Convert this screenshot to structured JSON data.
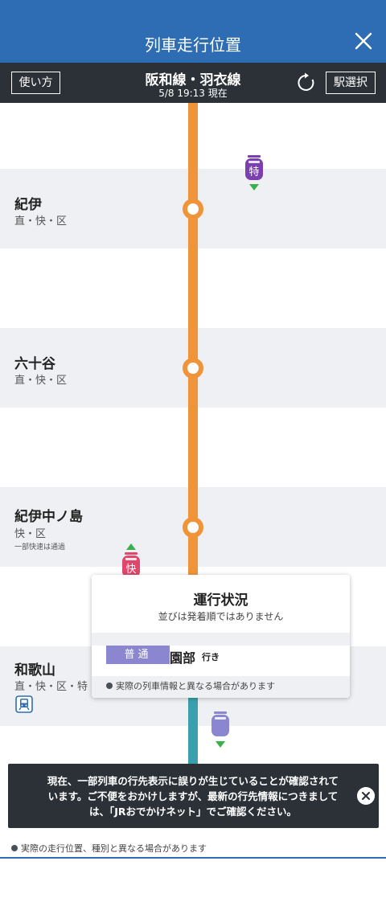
{
  "header": {
    "title": "列車走行位置",
    "close_icon": "close-icon"
  },
  "subheader": {
    "usage_label": "使い方",
    "line_name": "阪和線・羽衣線",
    "timestamp": "5/8 19:13 現在",
    "refresh_icon": "refresh-icon",
    "station_select_label": "駅選択"
  },
  "stations": [
    {
      "name": "紀伊",
      "types": "直・快・区"
    },
    {
      "name": "六十谷",
      "types": "直・快・区"
    },
    {
      "name": "紀伊中ノ島",
      "types": "快・区",
      "note": "一部快速は通過"
    },
    {
      "name": "和歌山",
      "types": "直・快・区・特",
      "icon": "train-station-icon"
    }
  ],
  "trains": [
    {
      "label": "特",
      "color": "#7b3fb0",
      "direction": "down"
    },
    {
      "label": "快",
      "color": "#e0476a",
      "direction": "up"
    },
    {
      "label": "",
      "color": "#8a86d0",
      "direction": "down"
    }
  ],
  "popup": {
    "title": "運行状況",
    "subtitle": "並びは発着順ではありません",
    "train_type": "普通",
    "destination": "園部",
    "destination_suffix": "行き",
    "note": "実際の列車情報と異なる場合があります"
  },
  "toast": {
    "message": "現在、一部列車の行先表示に誤りが生じていることが確認されています。ご不便をおかけしますが、最新の行先情報につきましては、「JRおでかけネット」でご確認ください。"
  },
  "footer": {
    "note": "実際の走行位置、種別と異なる場合があります"
  },
  "colors": {
    "header": "#2e6db4",
    "subheader": "#2c3138",
    "track_orange": "#f0943a",
    "track_teal": "#3aa0ad"
  }
}
